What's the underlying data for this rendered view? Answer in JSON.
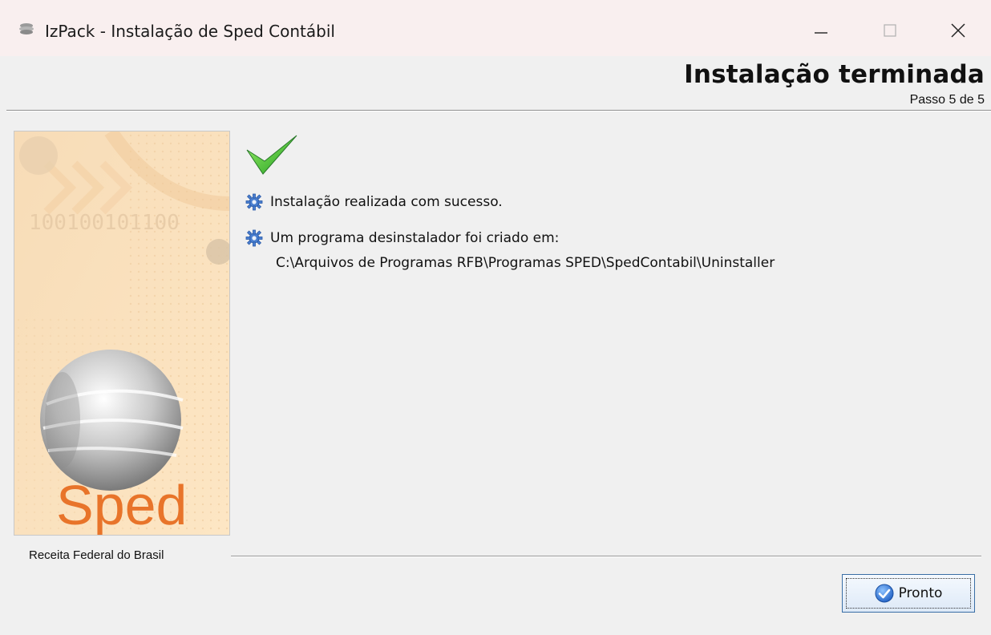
{
  "window": {
    "title": "IzPack - Instalação de  Sped Contábil",
    "controls": {
      "minimize": "minimize-icon",
      "maximize": "maximize-icon",
      "close": "close-icon"
    }
  },
  "header": {
    "title": "Instalação terminada",
    "step": "Passo 5 de 5"
  },
  "side_panel": {
    "logo_text": "Sped",
    "binary_text": "100100101100",
    "logo_color": "#e8742a"
  },
  "content": {
    "status_icon": "checkmark-icon",
    "messages": [
      {
        "icon": "gear-icon",
        "text": "Instalação realizada com sucesso."
      },
      {
        "icon": "gear-icon",
        "text": "Um programa desinstalador foi criado em:"
      }
    ],
    "uninstaller_path": "C:\\Arquivos de Programas RFB\\Programas SPED\\SpedContabil\\Uninstaller"
  },
  "footer": {
    "organization": "Receita Federal do Brasil",
    "done_button": "Pronto",
    "done_icon": "check-circle-icon"
  }
}
